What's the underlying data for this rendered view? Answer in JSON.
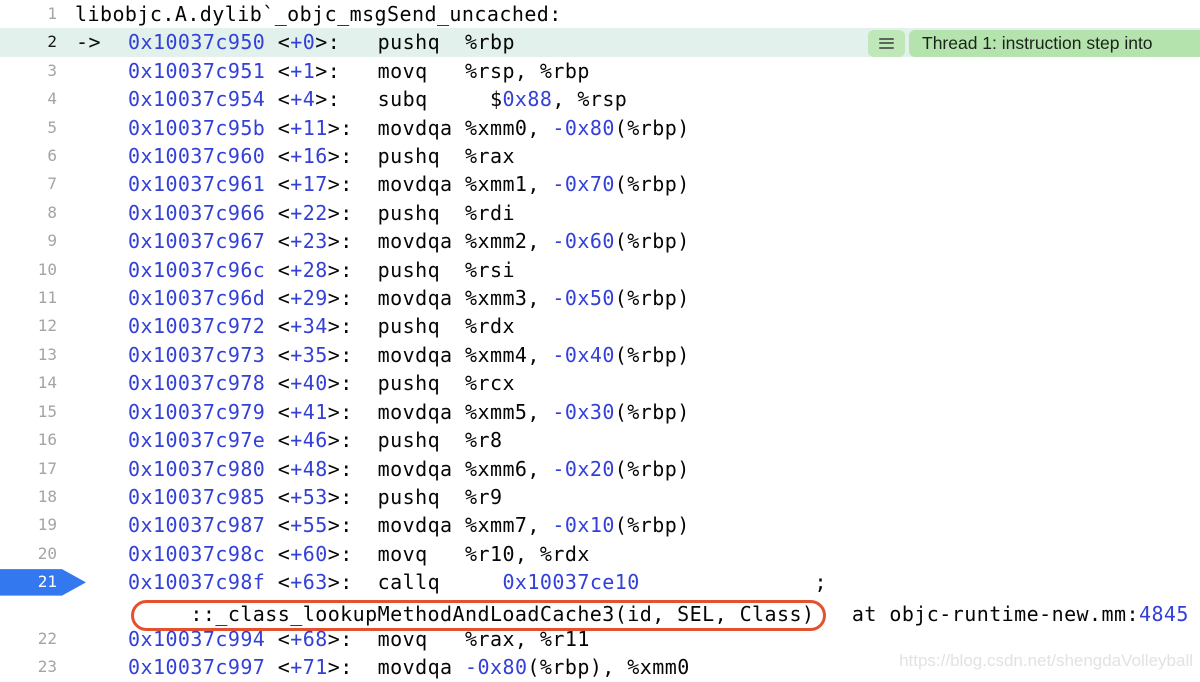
{
  "colors": {
    "background": "#ffffff",
    "code_text": "#050505",
    "literal_blue": "#3340D8",
    "line_number_gray": "#A4A4A4",
    "current_line_number": "#151515",
    "current_row_highlight": "#E2F1EB",
    "breakpoint_blue": "#3478F0",
    "annotation_red": "#E5502D",
    "badge_green_icon_chip": "#BFE7B8",
    "badge_green_label_chip": "#B5E3AE",
    "badge_text": "#1B221B",
    "watermark_gray": "#E2E2E5"
  },
  "badge": {
    "icon": "hamburger-menu-icon",
    "text": "Thread 1: instruction step into"
  },
  "watermark": {
    "text": "https://blog.csdn.net/shengdaVolleyball"
  },
  "code": {
    "arrow": "->",
    "rows": [
      {
        "num": "1",
        "type": "label",
        "segs": [
          [
            "k",
            "libobjc.A.dylib`_objc_msgSend_uncached:"
          ]
        ]
      },
      {
        "num": "2",
        "type": "asm",
        "current": true,
        "segs": [
          [
            "b",
            "0x10037c950"
          ],
          [
            "k",
            " <"
          ],
          [
            "b",
            "+0"
          ],
          [
            "k",
            ">:   pushq  %rbp"
          ]
        ]
      },
      {
        "num": "3",
        "type": "asm",
        "segs": [
          [
            "b",
            "0x10037c951"
          ],
          [
            "k",
            " <"
          ],
          [
            "b",
            "+1"
          ],
          [
            "k",
            ">:   movq   %rsp, %rbp"
          ]
        ]
      },
      {
        "num": "4",
        "type": "asm",
        "segs": [
          [
            "b",
            "0x10037c954"
          ],
          [
            "k",
            " <"
          ],
          [
            "b",
            "+4"
          ],
          [
            "k",
            ">:   subq     $"
          ],
          [
            "b",
            "0x88"
          ],
          [
            "k",
            ", %rsp"
          ]
        ]
      },
      {
        "num": "5",
        "type": "asm",
        "segs": [
          [
            "b",
            "0x10037c95b"
          ],
          [
            "k",
            " <"
          ],
          [
            "b",
            "+11"
          ],
          [
            "k",
            ">:  movdqa %xmm0, "
          ],
          [
            "b",
            "-0x80"
          ],
          [
            "k",
            "(%rbp)"
          ]
        ]
      },
      {
        "num": "6",
        "type": "asm",
        "segs": [
          [
            "b",
            "0x10037c960"
          ],
          [
            "k",
            " <"
          ],
          [
            "b",
            "+16"
          ],
          [
            "k",
            ">:  pushq  %rax"
          ]
        ]
      },
      {
        "num": "7",
        "type": "asm",
        "segs": [
          [
            "b",
            "0x10037c961"
          ],
          [
            "k",
            " <"
          ],
          [
            "b",
            "+17"
          ],
          [
            "k",
            ">:  movdqa %xmm1, "
          ],
          [
            "b",
            "-0x70"
          ],
          [
            "k",
            "(%rbp)"
          ]
        ]
      },
      {
        "num": "8",
        "type": "asm",
        "segs": [
          [
            "b",
            "0x10037c966"
          ],
          [
            "k",
            " <"
          ],
          [
            "b",
            "+22"
          ],
          [
            "k",
            ">:  pushq  %rdi"
          ]
        ]
      },
      {
        "num": "9",
        "type": "asm",
        "segs": [
          [
            "b",
            "0x10037c967"
          ],
          [
            "k",
            " <"
          ],
          [
            "b",
            "+23"
          ],
          [
            "k",
            ">:  movdqa %xmm2, "
          ],
          [
            "b",
            "-0x60"
          ],
          [
            "k",
            "(%rbp)"
          ]
        ]
      },
      {
        "num": "10",
        "type": "asm",
        "segs": [
          [
            "b",
            "0x10037c96c"
          ],
          [
            "k",
            " <"
          ],
          [
            "b",
            "+28"
          ],
          [
            "k",
            ">:  pushq  %rsi"
          ]
        ]
      },
      {
        "num": "11",
        "type": "asm",
        "segs": [
          [
            "b",
            "0x10037c96d"
          ],
          [
            "k",
            " <"
          ],
          [
            "b",
            "+29"
          ],
          [
            "k",
            ">:  movdqa %xmm3, "
          ],
          [
            "b",
            "-0x50"
          ],
          [
            "k",
            "(%rbp)"
          ]
        ]
      },
      {
        "num": "12",
        "type": "asm",
        "segs": [
          [
            "b",
            "0x10037c972"
          ],
          [
            "k",
            " <"
          ],
          [
            "b",
            "+34"
          ],
          [
            "k",
            ">:  pushq  %rdx"
          ]
        ]
      },
      {
        "num": "13",
        "type": "asm",
        "segs": [
          [
            "b",
            "0x10037c973"
          ],
          [
            "k",
            " <"
          ],
          [
            "b",
            "+35"
          ],
          [
            "k",
            ">:  movdqa %xmm4, "
          ],
          [
            "b",
            "-0x40"
          ],
          [
            "k",
            "(%rbp)"
          ]
        ]
      },
      {
        "num": "14",
        "type": "asm",
        "segs": [
          [
            "b",
            "0x10037c978"
          ],
          [
            "k",
            " <"
          ],
          [
            "b",
            "+40"
          ],
          [
            "k",
            ">:  pushq  %rcx"
          ]
        ]
      },
      {
        "num": "15",
        "type": "asm",
        "segs": [
          [
            "b",
            "0x10037c979"
          ],
          [
            "k",
            " <"
          ],
          [
            "b",
            "+41"
          ],
          [
            "k",
            ">:  movdqa %xmm5, "
          ],
          [
            "b",
            "-0x30"
          ],
          [
            "k",
            "(%rbp)"
          ]
        ]
      },
      {
        "num": "16",
        "type": "asm",
        "segs": [
          [
            "b",
            "0x10037c97e"
          ],
          [
            "k",
            " <"
          ],
          [
            "b",
            "+46"
          ],
          [
            "k",
            ">:  pushq  %r8"
          ]
        ]
      },
      {
        "num": "17",
        "type": "asm",
        "segs": [
          [
            "b",
            "0x10037c980"
          ],
          [
            "k",
            " <"
          ],
          [
            "b",
            "+48"
          ],
          [
            "k",
            ">:  movdqa %xmm6, "
          ],
          [
            "b",
            "-0x20"
          ],
          [
            "k",
            "(%rbp)"
          ]
        ]
      },
      {
        "num": "18",
        "type": "asm",
        "segs": [
          [
            "b",
            "0x10037c985"
          ],
          [
            "k",
            " <"
          ],
          [
            "b",
            "+53"
          ],
          [
            "k",
            ">:  pushq  %r9"
          ]
        ]
      },
      {
        "num": "19",
        "type": "asm",
        "segs": [
          [
            "b",
            "0x10037c987"
          ],
          [
            "k",
            " <"
          ],
          [
            "b",
            "+55"
          ],
          [
            "k",
            ">:  movdqa %xmm7, "
          ],
          [
            "b",
            "-0x10"
          ],
          [
            "k",
            "(%rbp)"
          ]
        ]
      },
      {
        "num": "20",
        "type": "asm",
        "segs": [
          [
            "b",
            "0x10037c98c"
          ],
          [
            "k",
            " <"
          ],
          [
            "b",
            "+60"
          ],
          [
            "k",
            ">:  movq   %r10, %rdx"
          ]
        ]
      },
      {
        "num": "21",
        "type": "asm",
        "breakpoint": true,
        "segs": [
          [
            "b",
            "0x10037c98f"
          ],
          [
            "k",
            " <"
          ],
          [
            "b",
            "+63"
          ],
          [
            "k",
            ">:  callq     "
          ],
          [
            "b",
            "0x10037ce10"
          ],
          [
            "k",
            "              ;"
          ]
        ]
      },
      {
        "num": "",
        "type": "comment",
        "annotated": true,
        "segs": [
          [
            "k",
            "     ::_class_lookupMethodAndLoadCache3(id, SEL, Class)   at objc-runtime-new.mm:"
          ],
          [
            "b",
            "4845"
          ]
        ]
      },
      {
        "num": "22",
        "type": "asm",
        "segs": [
          [
            "b",
            "0x10037c994"
          ],
          [
            "k",
            " <"
          ],
          [
            "b",
            "+68"
          ],
          [
            "k",
            ">:  movq   %rax, %r11"
          ]
        ]
      },
      {
        "num": "23",
        "type": "asm",
        "segs": [
          [
            "b",
            "0x10037c997"
          ],
          [
            "k",
            " <"
          ],
          [
            "b",
            "+71"
          ],
          [
            "k",
            ">:  movdqa "
          ],
          [
            "b",
            "-0x80"
          ],
          [
            "k",
            "(%rbp), %xmm0"
          ]
        ]
      }
    ]
  }
}
